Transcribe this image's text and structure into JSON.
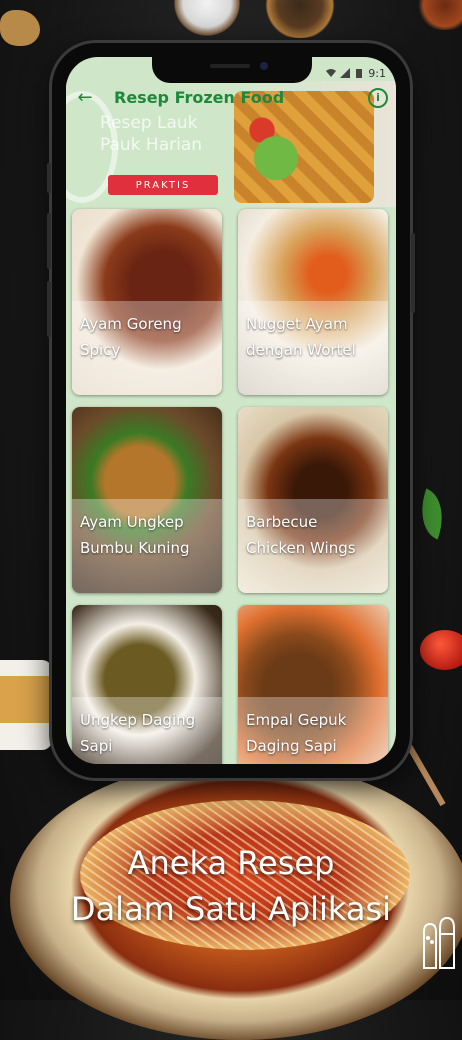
{
  "app": {
    "title": "Resep Frozen Food",
    "status_time": "9:1"
  },
  "header": {
    "faded_line1": "Resep Lauk",
    "faded_line2": "Pauk Harian",
    "pill": "PRAKTIS"
  },
  "recipes": [
    {
      "title_line1": "Ayam Goreng",
      "title_line2": "Spicy"
    },
    {
      "title_line1": "Nugget Ayam",
      "title_line2": "dengan Wortel"
    },
    {
      "title_line1": "Ayam Ungkep",
      "title_line2": "Bumbu Kuning"
    },
    {
      "title_line1": "Barbecue",
      "title_line2": "Chicken Wings"
    },
    {
      "title_line1": "Ungkep Daging",
      "title_line2": "Sapi"
    },
    {
      "title_line1": "Empal Gepuk",
      "title_line2": "Daging Sapi"
    }
  ],
  "tagline": {
    "line1": "Aneka Resep",
    "line2": "Dalam Satu Aplikasi"
  },
  "icons": {
    "back": "arrow-left-icon",
    "info": "info-circle-icon",
    "salt": "salt-pepper-shaker-icon"
  },
  "colors": {
    "accent": "#1d8a3a",
    "pill": "#e0303d",
    "header_bg": "#cfe6c8"
  }
}
